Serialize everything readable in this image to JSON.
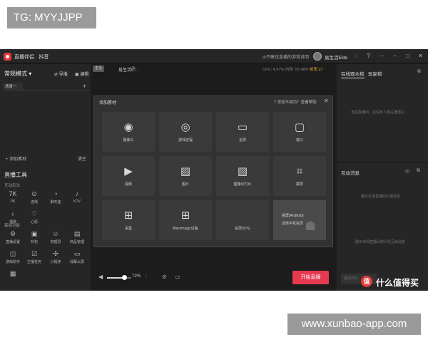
{
  "overlays": {
    "top_tag": "TG: MYYJJPP",
    "bottom_tag": "www.xunbao-app.com"
  },
  "titlebar": {
    "app_name": "直播伴侣",
    "separator": "·",
    "platform": "抖音",
    "notice": "不建议直播的游戏说明",
    "user_name": "易生活Elife",
    "icons": [
      "help-circle-icon",
      "settings-icon",
      "menu-icon",
      "minimize-icon",
      "maximize-icon",
      "close-icon"
    ]
  },
  "left_panel": {
    "mode_label": "常规模式",
    "import_label": "导播",
    "edit_label": "编辑",
    "scene_tab": "场景一",
    "add_source_label": "添加素材",
    "clear_label": "清空",
    "tools_title": "直播工具",
    "interactive_title": "互动玩法",
    "interactive_tools": [
      {
        "label": "PK",
        "icon": "pk-icon",
        "glyph": "7K"
      },
      {
        "label": "连线",
        "icon": "link-icon",
        "glyph": "⊙"
      },
      {
        "label": "聊天室",
        "icon": "chat-room-icon",
        "glyph": "◔"
      },
      {
        "label": "KTV",
        "icon": "microphone-icon",
        "glyph": "♪"
      },
      {
        "label": "福袋",
        "icon": "lucky-bag-icon",
        "glyph": "♁"
      },
      {
        "label": "心愿",
        "icon": "wish-icon",
        "glyph": "♡"
      }
    ],
    "basic_title": "基础功能",
    "basic_tools": [
      {
        "label": "直播设置",
        "icon": "live-settings-icon",
        "glyph": "⚙"
      },
      {
        "label": "背包",
        "icon": "backpack-icon",
        "glyph": "▣"
      },
      {
        "label": "管理员",
        "icon": "admin-icon",
        "glyph": "☺"
      },
      {
        "label": "商品管理",
        "icon": "product-icon",
        "glyph": "▤"
      },
      {
        "label": "游戏助手",
        "icon": "gamepad-icon",
        "glyph": "◫"
      },
      {
        "label": "主播任务",
        "icon": "task-icon",
        "glyph": "☑"
      },
      {
        "label": "小程序",
        "icon": "mini-program-icon",
        "glyph": "✣"
      },
      {
        "label": "绿幕大屏",
        "icon": "green-screen-icon",
        "glyph": "▭"
      },
      {
        "label": "",
        "icon": "more-icon",
        "glyph": "▦"
      }
    ]
  },
  "center": {
    "live_badge": "生活",
    "room_title": "易生活E...",
    "stat_cpu": "CPU: 4.97%",
    "stat_mem": "内存: 55.48%",
    "stat_net": "帧率:27"
  },
  "dialog": {
    "title": "添加素材",
    "help": "添加不成功？查看帮助",
    "items": [
      {
        "label": "摄像头",
        "icon": "webcam-icon",
        "glyph": "◉"
      },
      {
        "label": "游戏进程",
        "icon": "game-controller-icon",
        "glyph": "◎"
      },
      {
        "label": "全屏",
        "icon": "monitor-icon",
        "glyph": "▭"
      },
      {
        "label": "窗口",
        "icon": "window-icon",
        "glyph": "▢"
      },
      {
        "label": "视频",
        "icon": "play-circle-icon",
        "glyph": "▶"
      },
      {
        "label": "图片",
        "icon": "image-icon",
        "glyph": "▨"
      },
      {
        "label": "图像幻灯片",
        "icon": "slideshow-icon",
        "glyph": "▧"
      },
      {
        "label": "截屏",
        "icon": "crop-icon",
        "glyph": "⌗"
      },
      {
        "label": "采集",
        "icon": "capture-network-icon",
        "glyph": "⊞"
      },
      {
        "label": "Blackmagic设备",
        "icon": "blackmagic-network-icon",
        "glyph": "⊞"
      },
      {
        "label": "投屏(iOS)",
        "icon": "apple-icon",
        "glyph": ""
      },
      {
        "label": "投屏(Android)",
        "icon": "android-icon",
        "glyph": "",
        "sub": "选择手机投屏"
      }
    ]
  },
  "bottom_bar": {
    "volume_percent": 72,
    "volume_label": "72%",
    "start_label": "开始直播"
  },
  "right_panel": {
    "tab_audience": "在线观众榜",
    "tab_players": "玩家榜",
    "audience_empty": "当前直播间，还没有人给主播送礼",
    "interaction_title": "互动消息",
    "interaction_empty_1": "展示本场直播的礼物消息",
    "interaction_empty_2": "展示本场直播间的评论互动消息",
    "message_placeholder": "说点什么"
  },
  "watermark": {
    "logo": "值",
    "text": "什么值得买"
  },
  "colors": {
    "accent": "#e5394f",
    "panel": "#262626",
    "background": "#1e1e1e",
    "warning": "#e0a02a"
  }
}
